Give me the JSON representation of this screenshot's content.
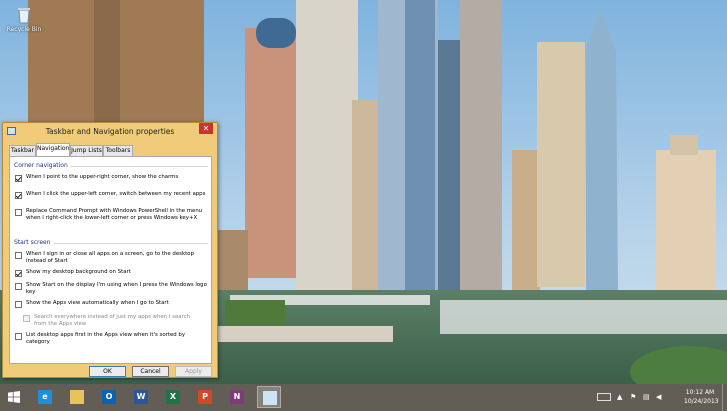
{
  "desktop": {
    "recycle_bin_label": "Recycle Bin"
  },
  "dialog": {
    "title": "Taskbar and Navigation properties",
    "close_glyph": "✕",
    "tabs": [
      {
        "label": "Taskbar",
        "active": false
      },
      {
        "label": "Navigation",
        "active": true
      },
      {
        "label": "Jump Lists",
        "active": false
      },
      {
        "label": "Toolbars",
        "active": false
      }
    ],
    "corner_navigation": {
      "heading": "Corner navigation",
      "options": [
        {
          "label": "When I point to the upper-right corner, show the charms",
          "checked": true
        },
        {
          "label": "When I click the upper-left corner, switch between my recent apps",
          "checked": true
        },
        {
          "label": "Replace Command Prompt with Windows PowerShell in the menu when I right-click the lower-left corner or press Windows key+X",
          "checked": false
        }
      ]
    },
    "start_screen": {
      "heading": "Start screen",
      "options": [
        {
          "label": "When I sign in or close all apps on a screen, go to the desktop instead of Start",
          "checked": false,
          "disabled": false
        },
        {
          "label": "Show my desktop background on Start",
          "checked": true,
          "disabled": false
        },
        {
          "label": "Show Start on the display I'm using when I press the Windows logo key",
          "checked": false,
          "disabled": false
        },
        {
          "label": "Show the Apps view automatically when I go to Start",
          "checked": false,
          "disabled": false
        },
        {
          "label": "Search everywhere instead of just my apps when I search from the Apps view",
          "checked": false,
          "disabled": true
        },
        {
          "label": "List desktop apps first in the Apps view when it's sorted by category",
          "checked": false,
          "disabled": false
        }
      ]
    },
    "buttons": {
      "ok": "OK",
      "cancel": "Cancel",
      "apply": "Apply"
    }
  },
  "taskbar": {
    "apps": [
      {
        "name": "Internet Explorer",
        "icon": "internet-explorer-icon",
        "glyph": "e",
        "color": "#1e8fd8"
      },
      {
        "name": "File Explorer",
        "icon": "file-explorer-icon",
        "glyph": "",
        "color": "#e8c25a"
      },
      {
        "name": "Outlook",
        "icon": "outlook-icon",
        "glyph": "O",
        "color": "#0a64b4"
      },
      {
        "name": "Word",
        "icon": "word-icon",
        "glyph": "W",
        "color": "#2b579a"
      },
      {
        "name": "Excel",
        "icon": "excel-icon",
        "glyph": "X",
        "color": "#217346"
      },
      {
        "name": "PowerPoint",
        "icon": "powerpoint-icon",
        "glyph": "P",
        "color": "#d24726"
      },
      {
        "name": "OneNote",
        "icon": "onenote-icon",
        "glyph": "N",
        "color": "#80397b"
      },
      {
        "name": "Taskbar properties",
        "icon": "taskbar-properties-icon",
        "glyph": "",
        "color": "#cfe3f7",
        "active": true
      }
    ],
    "tray_icons": [
      "keyboard-icon",
      "up-arrow-icon",
      "flag-icon",
      "network-icon",
      "volume-icon"
    ],
    "time": "10:12 AM",
    "date": "10/24/2013"
  }
}
